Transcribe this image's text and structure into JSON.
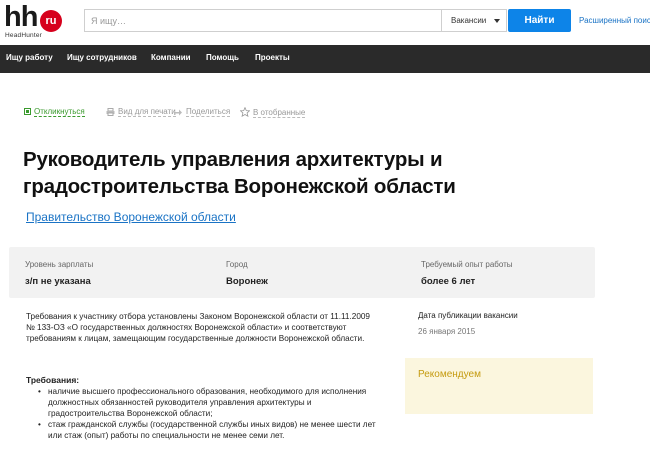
{
  "header": {
    "logo_text": "hh",
    "logo_badge": "ru",
    "logo_subtitle": "HeadHunter",
    "search_placeholder": "Я ищу…",
    "search_scope": "Вакансии",
    "search_button": "Найти",
    "advanced_search": "Расширенный поиск"
  },
  "nav": {
    "items": [
      {
        "label": "Ищу работу"
      },
      {
        "label": "Ищу сотрудников"
      },
      {
        "label": "Компании"
      },
      {
        "label": "Помощь"
      },
      {
        "label": "Проекты"
      }
    ]
  },
  "actions": {
    "respond": "Откликнуться",
    "print": "Вид для печати",
    "share": "Поделиться",
    "favorite": "В отобранные"
  },
  "vacancy": {
    "title": "Руководитель управления архитектуры и градостроительства Воронежской области",
    "company": "Правительство Воронежской области",
    "info": [
      {
        "label": "Уровень зарплаты",
        "value": "з/п не указана"
      },
      {
        "label": "Город",
        "value": "Воронеж"
      },
      {
        "label": "Требуемый опыт работы",
        "value": "более 6 лет"
      }
    ],
    "description": "Требования к участнику отбора установлены Законом Воронежской области от 11.11.2009 № 133-ОЗ «О государственных должностях Воронежской области» и соответствуют требованиям к лицам, замещающим государственные должности Воронежской области.",
    "requirements_title": "Требования:",
    "requirements": [
      "наличие высшего профессионального образования, необходимого для исполнения должностных обязанностей руководителя управления архитектуры и градостроительства Воронежской области;",
      "стаж гражданской службы (государственной службы иных видов) не менее шести лет или стаж (опыт) работы по специальности не менее семи лет."
    ]
  },
  "side": {
    "publication_label": "Дата публикации вакансии",
    "publication_date": "26 января 2015",
    "recommend_title": "Рекомендуем"
  },
  "colors": {
    "nav_bg": "#2a2a2a",
    "search_button": "#0d84e8",
    "link": "#1a73c5",
    "respond_green": "#3a9a2d",
    "logo_red": "#d6001c",
    "recommend_bg": "#fbf6de"
  }
}
